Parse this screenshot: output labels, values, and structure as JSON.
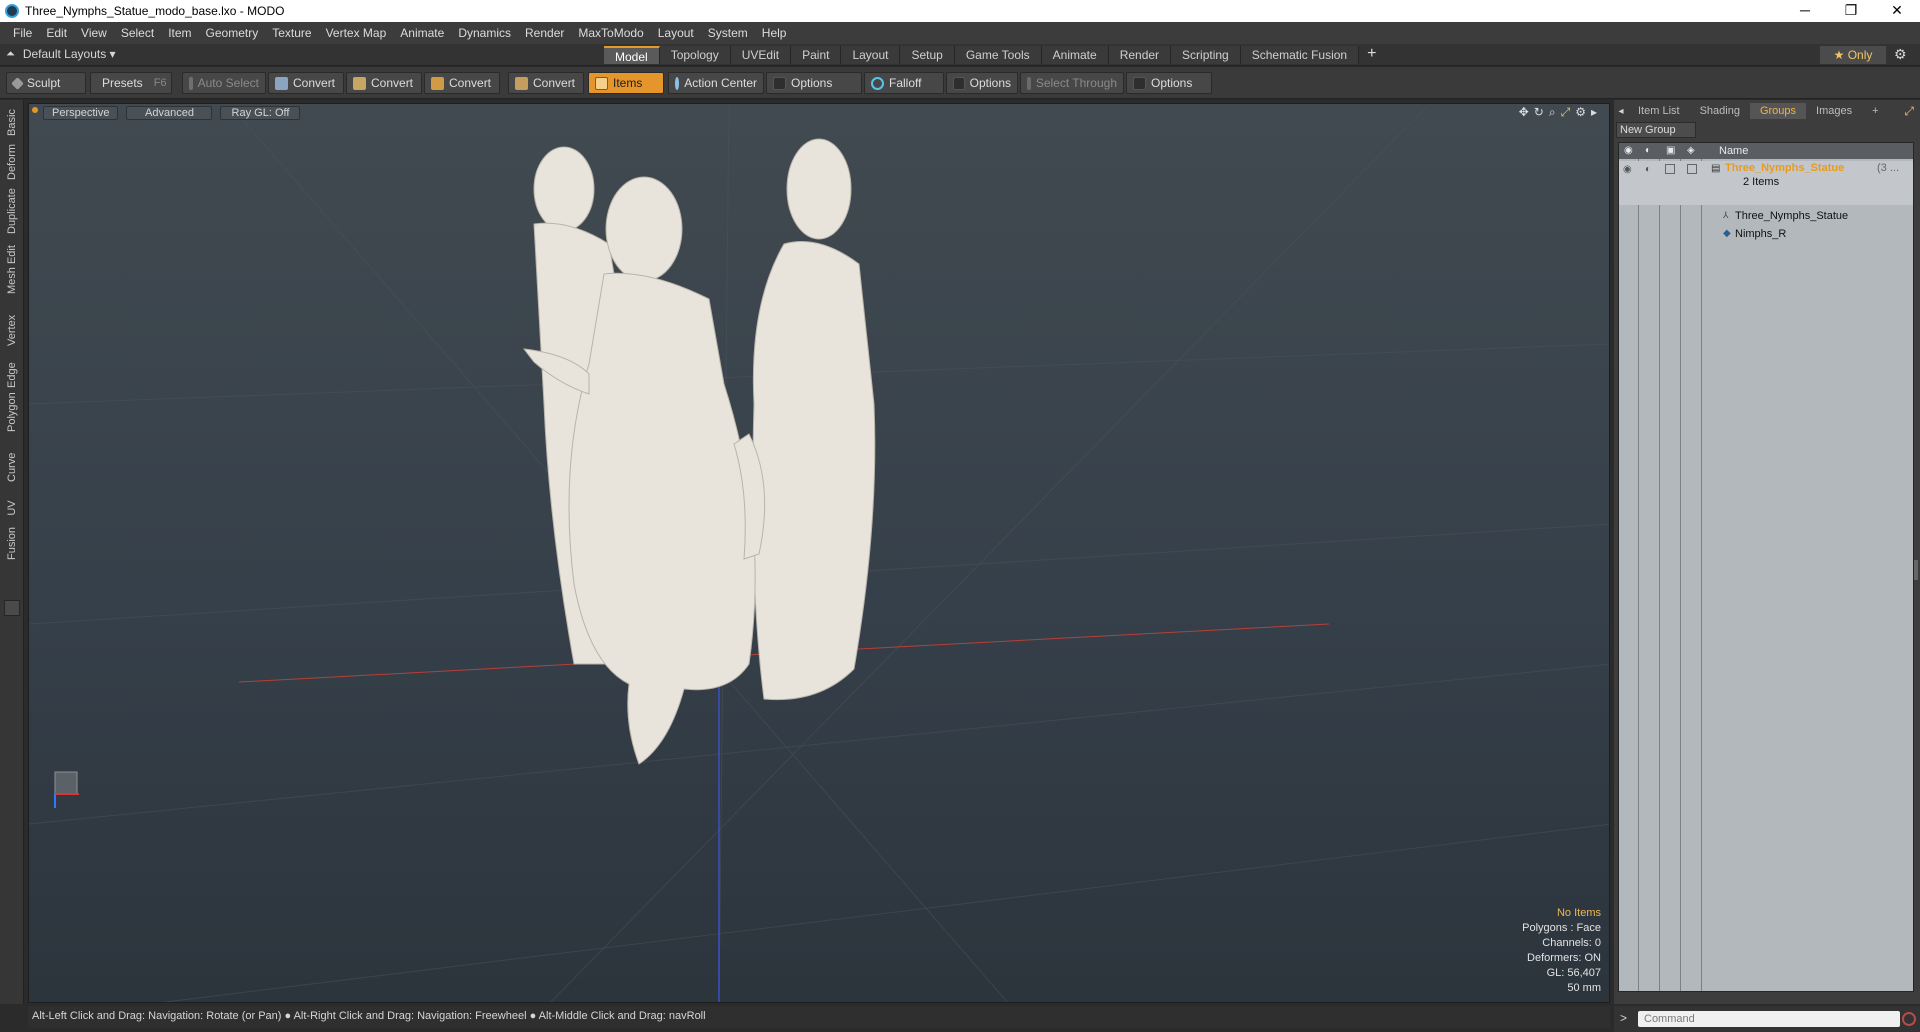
{
  "window": {
    "title": "Three_Nymphs_Statue_modo_base.lxo - MODO",
    "minimize": "─",
    "maximize": "❐",
    "close": "✕"
  },
  "menu": [
    "File",
    "Edit",
    "View",
    "Select",
    "Item",
    "Geometry",
    "Texture",
    "Vertex Map",
    "Animate",
    "Dynamics",
    "Render",
    "MaxToModo",
    "Layout",
    "System",
    "Help"
  ],
  "layouts": {
    "default_label": "Default Layouts ▾",
    "tabs": [
      "Model",
      "Topology",
      "UVEdit",
      "Paint",
      "Layout",
      "Setup",
      "Game Tools",
      "Animate",
      "Render",
      "Scripting",
      "Schematic Fusion"
    ],
    "active_tab": "Model",
    "add": "+",
    "only_label": "★ Only"
  },
  "toolbar": {
    "sculpt": "Sculpt",
    "presets": "Presets",
    "presets_hint": "F6",
    "auto_select": "Auto Select",
    "convert1": "Convert",
    "convert2": "Convert",
    "convert3": "Convert",
    "convert4": "Convert",
    "items": "Items",
    "action_center": "Action Center",
    "options1": "Options",
    "falloff": "Falloff",
    "options2": "Options",
    "select_through": "Select Through",
    "options3": "Options"
  },
  "left_tabs": [
    "Basic",
    "Deform",
    "Duplicate",
    "Mesh Edit",
    "Vertex",
    "Edge",
    "Polygon",
    "Curve",
    "UV",
    "Fusion"
  ],
  "viewport": {
    "view_mode": "Perspective",
    "shading": "Advanced",
    "raygl": "Ray GL: Off",
    "info": {
      "selection": "No Items",
      "polygons": "Polygons : Face",
      "channels": "Channels: 0",
      "deformers": "Deformers: ON",
      "gl": "GL: 56,407",
      "units": "50 mm"
    }
  },
  "right_panel": {
    "tabs": [
      "Item List",
      "Shading",
      "Groups",
      "Images",
      "+"
    ],
    "active_tab": "Groups",
    "new_group": "New Group",
    "column_name": "Name",
    "group_name": "Three_Nymphs_Statue",
    "group_suffix": "(3 ...",
    "group_count": "2 Items",
    "children": [
      "Three_Nymphs_Statue",
      "Nimphs_R"
    ]
  },
  "command": {
    "placeholder": "Command"
  },
  "status": {
    "hint": "Alt-Left Click and Drag: Navigation: Rotate (or Pan) ● Alt-Right Click and Drag: Navigation: Freewheel ● Alt-Middle Click and Drag: navRoll"
  },
  "colors": {
    "accent": "#e5962b",
    "group_highlight": "#f3b244",
    "statue": "#e8e4dc"
  }
}
